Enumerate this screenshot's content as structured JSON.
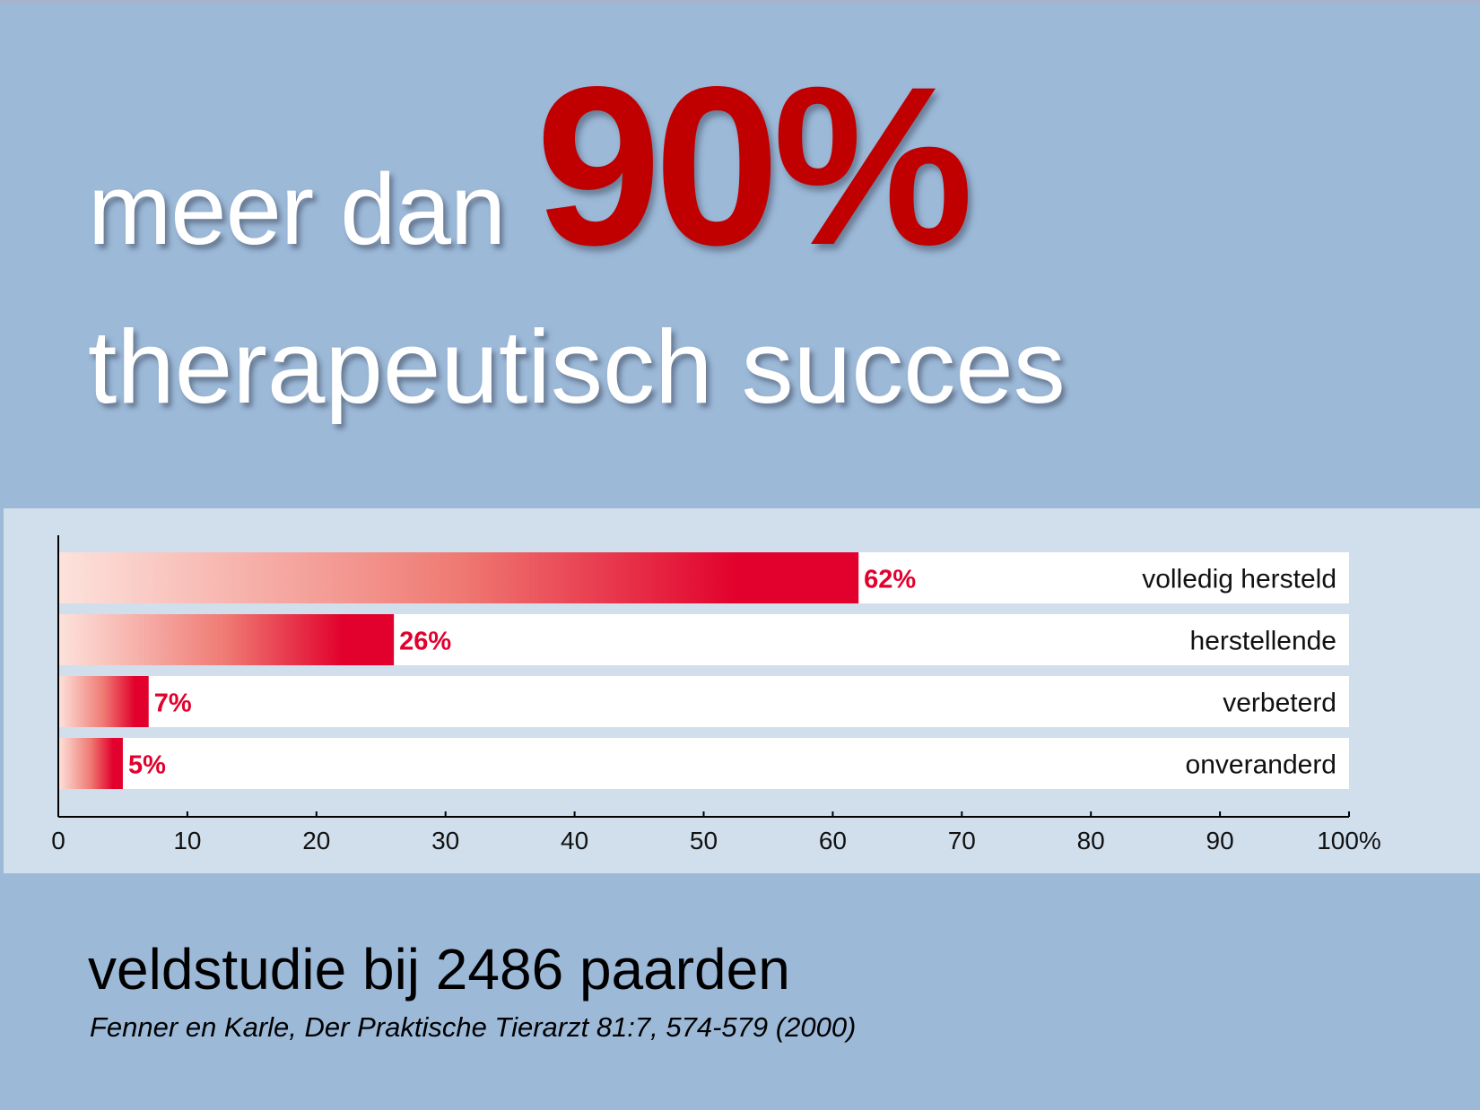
{
  "headline": {
    "lead": "meer dan",
    "number": "90%",
    "sub": "therapeutisch succes"
  },
  "footer": {
    "title": "veldstudie bij 2486 paarden",
    "citation": "Fenner en Karle, Der Praktische Tierarzt 81:7, 574-579 (2000)"
  },
  "colors": {
    "background": "#9cb9d8",
    "panel": "#d1dfed",
    "accent": "#c00000",
    "bar_dark": "#e2002c",
    "bar_light": "#fde2dc"
  },
  "chart_data": {
    "type": "bar",
    "orientation": "horizontal",
    "categories": [
      "volledig hersteld",
      "herstellende",
      "verbeterd",
      "onveranderd"
    ],
    "values": [
      62,
      26,
      7,
      5
    ],
    "data_labels": [
      "62%",
      "26%",
      "7%",
      "5%"
    ],
    "xlim": [
      0,
      100
    ],
    "xticks": [
      "0",
      "10",
      "20",
      "30",
      "40",
      "50",
      "60",
      "70",
      "80",
      "90",
      "100%"
    ],
    "grid": false,
    "legend": "none"
  }
}
